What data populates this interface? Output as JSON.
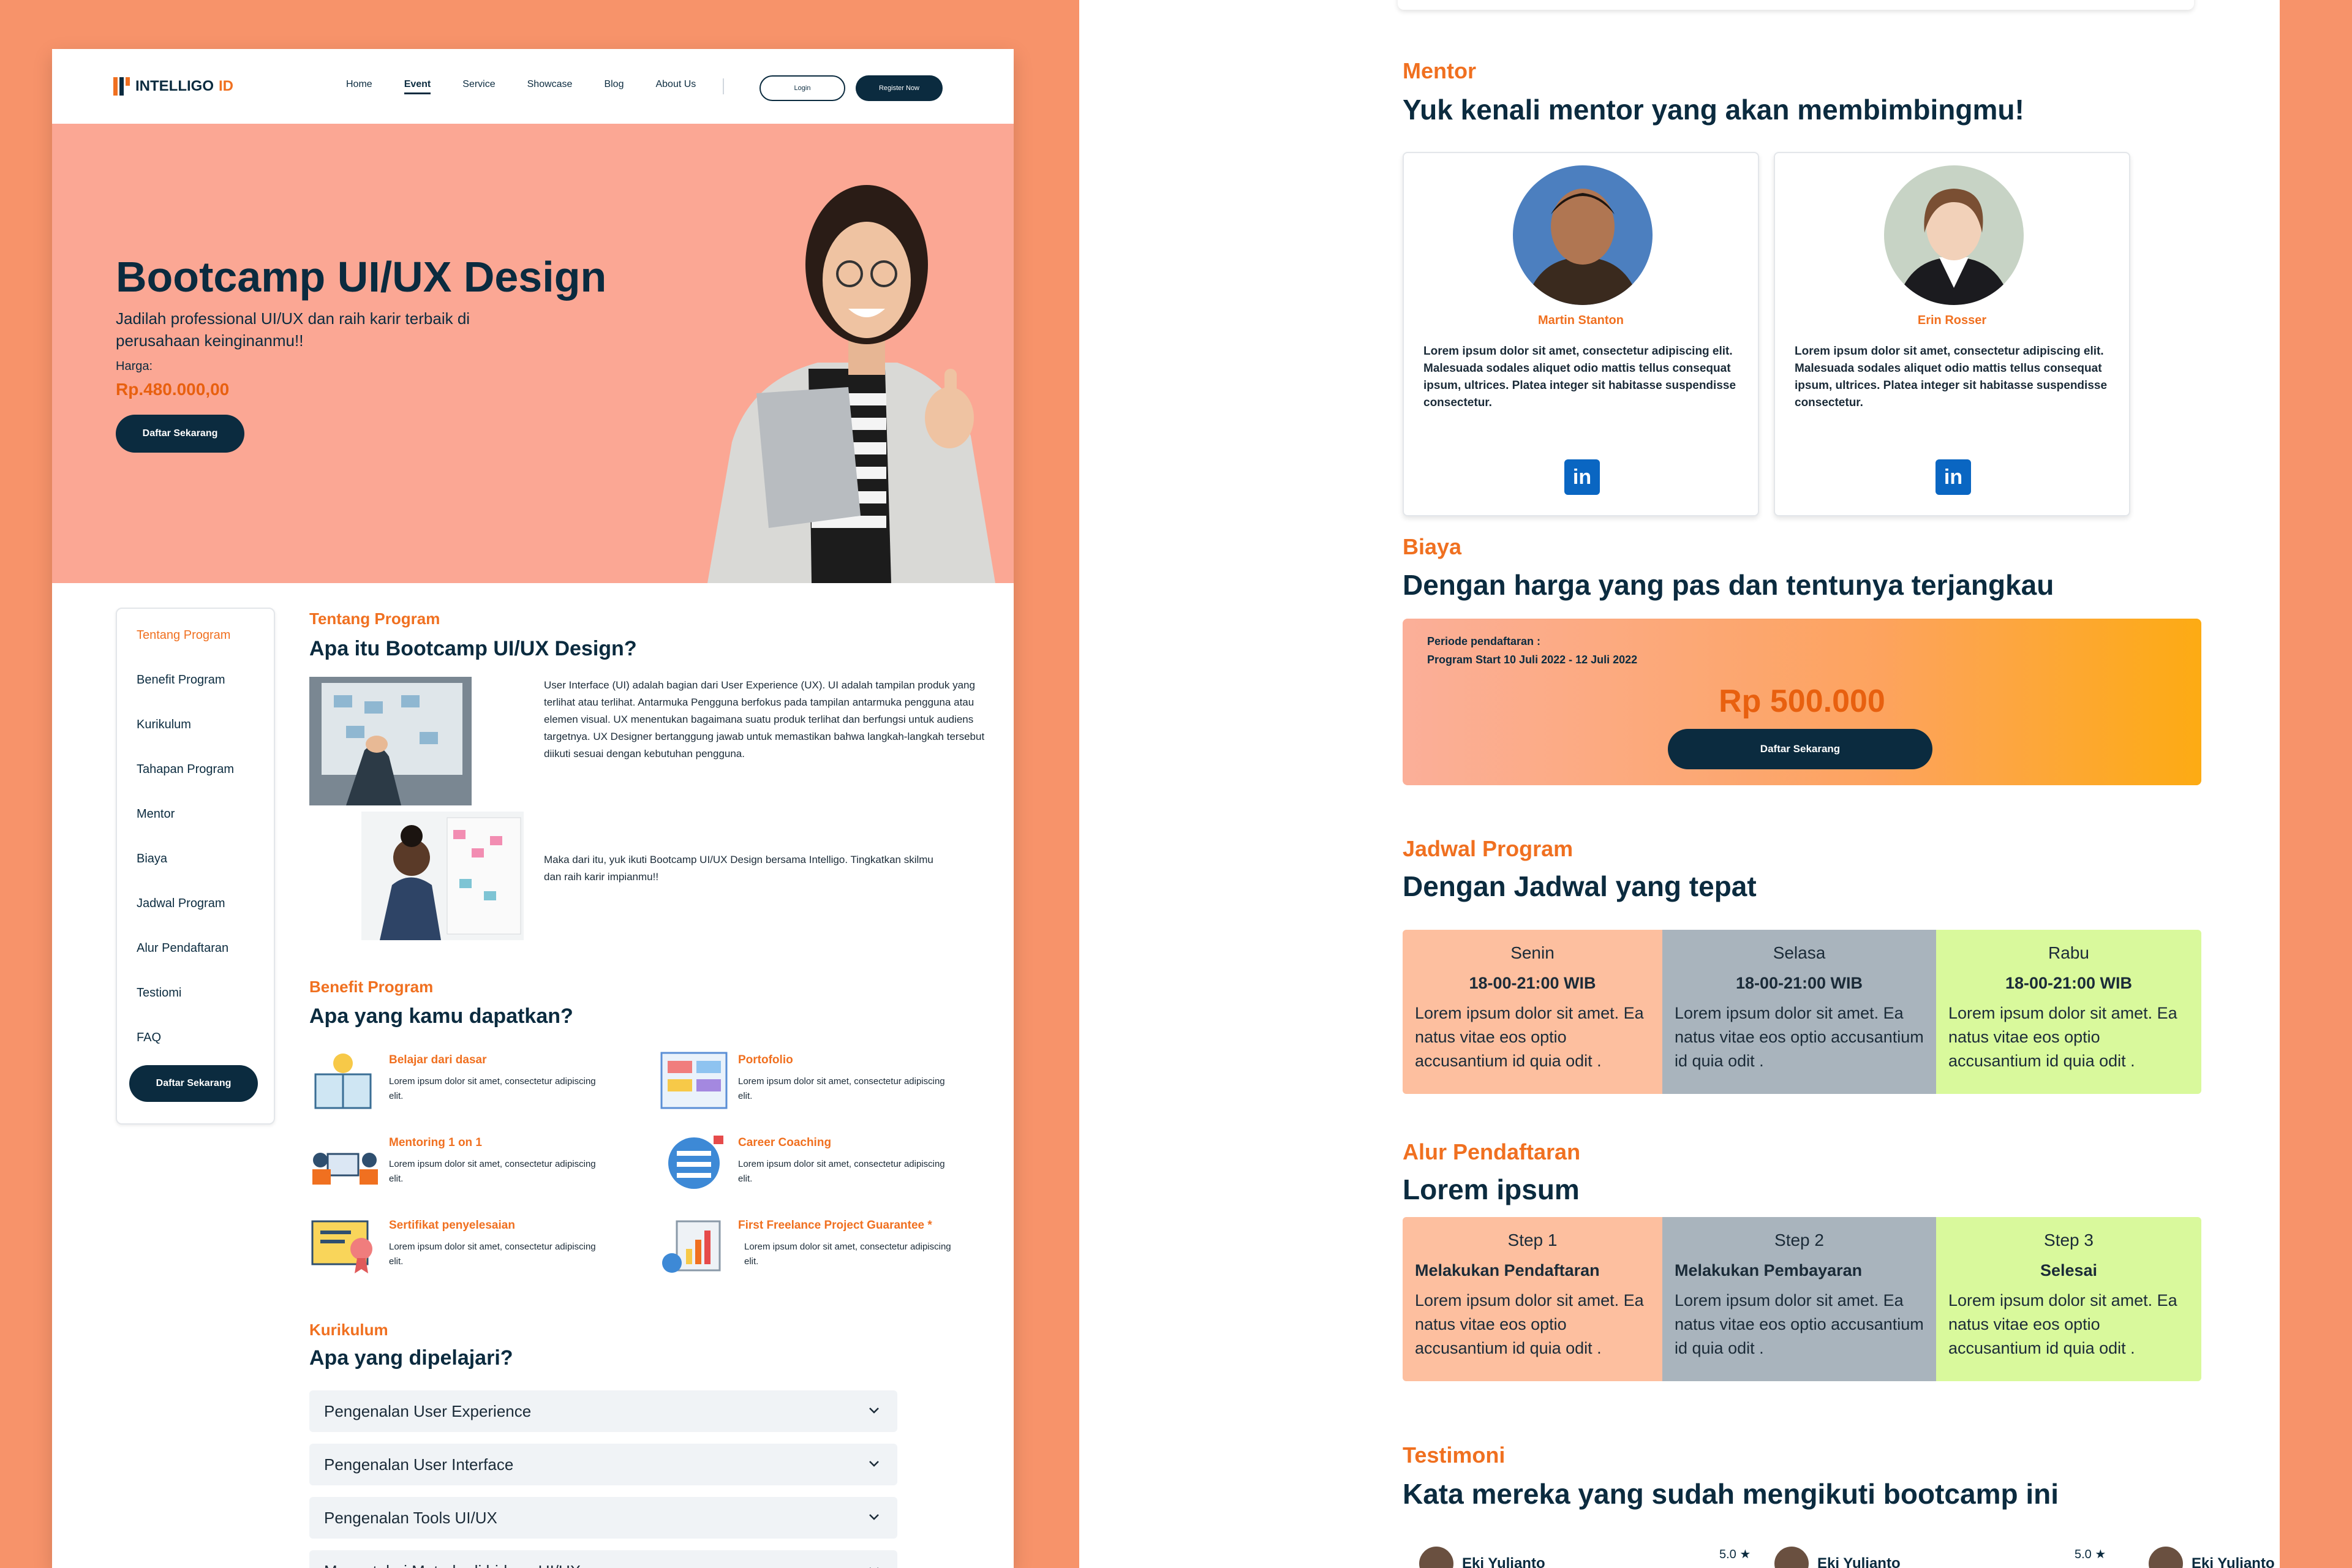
{
  "left": {
    "logo": {
      "brand": "INTELLIGO",
      "suffix": "ID"
    },
    "nav": {
      "home": "Home",
      "event": "Event",
      "service": "Service",
      "showcase": "Showcase",
      "blog": "Blog",
      "about": "About Us",
      "login": "Login",
      "register": "Register Now"
    },
    "hero": {
      "title": "Bootcamp UI/UX Design",
      "subtitle": "Jadilah professional UI/UX dan raih karir terbaik di perusahaan keinginanmu!!",
      "price_label": "Harga:",
      "price": "Rp.480.000,00",
      "cta": "Daftar Sekarang"
    },
    "side_menu": {
      "items": [
        "Tentang Program",
        "Benefit Program",
        "Kurikulum",
        "Tahapan Program",
        "Mentor",
        "Biaya",
        "Jadwal Program",
        "Alur Pendaftaran",
        "Testiomi",
        "FAQ"
      ],
      "cta": "Daftar Sekarang"
    },
    "about": {
      "label": "Tentang Program",
      "title": "Apa itu Bootcamp UI/UX Design?",
      "para1": "User Interface (UI) adalah bagian dari User Experience (UX). UI adalah tampilan produk yang terlihat atau terlihat. Antarmuka Pengguna berfokus pada tampilan antarmuka pengguna atau elemen visual. UX menentukan bagaimana suatu produk terlihat dan berfungsi untuk audiens targetnya. UX Designer bertanggung jawab untuk memastikan bahwa langkah-langkah tersebut diikuti sesuai dengan kebutuhan pengguna.",
      "para2": "Maka dari itu, yuk ikuti Bootcamp UI/UX Design bersama Intelligo. Tingkatkan skilmu dan raih karir impianmu!!"
    },
    "benefit": {
      "label": "Benefit Program",
      "title": "Apa yang kamu dapatkan?",
      "items": [
        {
          "title": "Belajar dari dasar",
          "desc": "Lorem ipsum dolor sit amet, consectetur adipiscing elit."
        },
        {
          "title": "Portofolio",
          "desc": "Lorem ipsum dolor sit amet, consectetur adipiscing elit."
        },
        {
          "title": "Mentoring 1 on 1",
          "desc": "Lorem ipsum dolor sit amet, consectetur adipiscing elit."
        },
        {
          "title": "Career Coaching",
          "desc": "Lorem ipsum dolor sit amet, consectetur adipiscing elit."
        },
        {
          "title": "Sertifikat penyelesaian",
          "desc": "Lorem ipsum dolor sit amet, consectetur adipiscing elit."
        },
        {
          "title": "First Freelance Project Guarantee *",
          "desc": "Lorem ipsum dolor sit amet, consectetur adipiscing elit."
        }
      ]
    },
    "curriculum": {
      "label": "Kurikulum",
      "title": "Apa yang dipelajari?",
      "items": [
        "Pengenalan User Experience",
        "Pengenalan User Interface",
        "Pengenalan Tools UI/UX",
        "Mengetahui Metode di bidang UI/UX"
      ]
    }
  },
  "right": {
    "mentor": {
      "label": "Mentor",
      "title": "Yuk kenali mentor yang akan membimbingmu!",
      "cards": [
        {
          "name": "Martin Stanton",
          "desc": "Lorem ipsum dolor sit amet, consectetur adipiscing elit. Malesuada sodales aliquet odio mattis tellus consequat ipsum, ultrices. Platea integer sit habitasse suspendisse consectetur.",
          "social": "in"
        },
        {
          "name": "Erin Rosser",
          "desc": "Lorem ipsum dolor sit amet, consectetur adipiscing elit. Malesuada sodales aliquet odio mattis tellus consequat ipsum, ultrices. Platea integer sit habitasse suspendisse consectetur.",
          "social": "in"
        }
      ]
    },
    "cost": {
      "label": "Biaya",
      "title": "Dengan harga yang pas dan tentunya terjangkau",
      "period_label": "Periode pendaftaran :",
      "period": "Program Start 10 Juli 2022 -  12 Juli 2022",
      "amount": "Rp 500.000",
      "cta": "Daftar Sekarang"
    },
    "schedule": {
      "label": "Jadwal Program",
      "title": "Dengan Jadwal yang tepat",
      "days": [
        {
          "day": "Senin",
          "time": "18-00-21:00 WIB",
          "desc": "Lorem ipsum dolor sit amet. Ea natus vitae eos optio accusantium id quia odit ."
        },
        {
          "day": "Selasa",
          "time": "18-00-21:00 WIB",
          "desc": "Lorem ipsum dolor sit amet. Ea natus vitae eos optio accusantium id quia odit ."
        },
        {
          "day": "Rabu",
          "time": "18-00-21:00 WIB",
          "desc": "Lorem ipsum dolor sit amet. Ea natus vitae eos optio accusantium id quia odit ."
        }
      ]
    },
    "registration": {
      "label": "Alur Pendaftaran",
      "title": "Lorem ipsum",
      "steps": [
        {
          "step": "Step 1",
          "name": "Melakukan Pendaftaran",
          "desc": "Lorem ipsum dolor sit amet. Ea natus vitae eos optio accusantium id quia odit ."
        },
        {
          "step": "Step 2",
          "name": "Melakukan Pembayaran",
          "desc": "Lorem ipsum dolor sit amet. Ea natus vitae eos optio accusantium id quia odit ."
        },
        {
          "step": "Step 3",
          "name": "Selesai",
          "desc": "Lorem ipsum dolor sit amet. Ea natus vitae eos optio accusantium id quia odit ."
        }
      ]
    },
    "testimoni": {
      "label": "Testimoni",
      "title": "Kata mereka yang sudah mengikuti bootcamp ini",
      "people": [
        {
          "name": "Eki Yulianto",
          "rating": "5.0 ★"
        },
        {
          "name": "Eki Yulianto",
          "rating": "5.0 ★"
        },
        {
          "name": "Eki Yulianto"
        }
      ]
    }
  },
  "colors": {
    "navy": "#0b2b3f",
    "orange": "#f07020",
    "salmon": "#fba794",
    "background": "#f7936a"
  }
}
